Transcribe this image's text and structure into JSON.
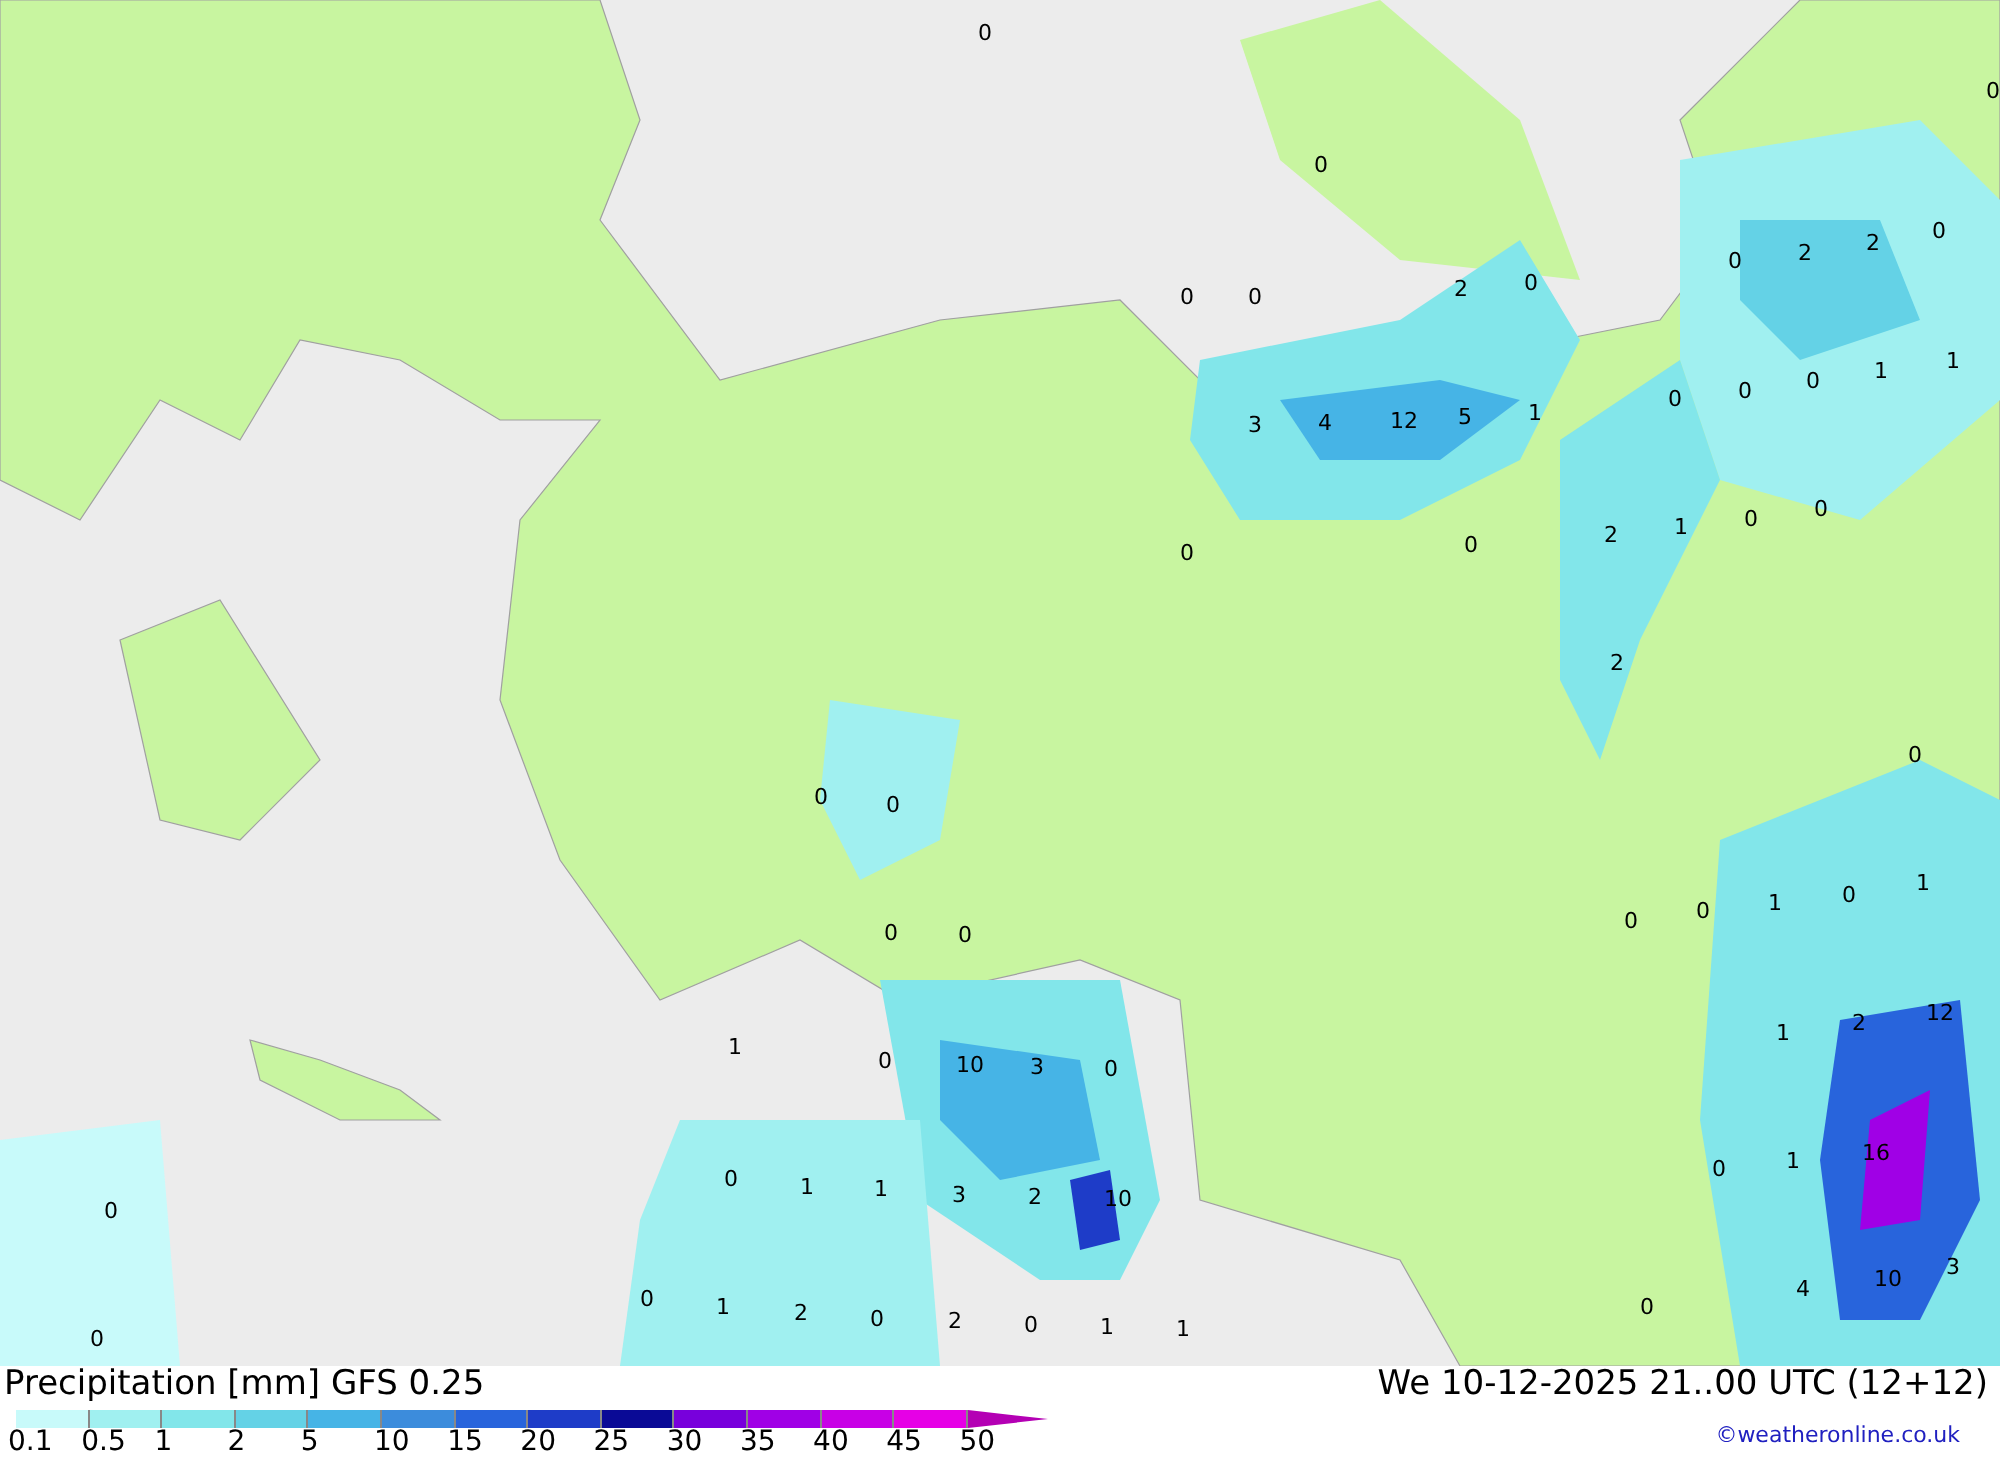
{
  "map_labels": [
    "0",
    "0",
    "0",
    "0",
    "2",
    "0",
    "0",
    "2",
    "2",
    "0",
    "3",
    "4",
    "12",
    "5",
    "1",
    "0",
    "0",
    "0",
    "1",
    "1",
    "0",
    "0",
    "0",
    "2",
    "1",
    "0",
    "0",
    "2",
    "0",
    "0",
    "0",
    "0",
    "0",
    "0",
    "0",
    "1",
    "0",
    "1",
    "1",
    "0",
    "10",
    "3",
    "0",
    "1",
    "2",
    "12",
    "0",
    "1",
    "1",
    "3",
    "2",
    "10",
    "0",
    "0",
    "1",
    "16",
    "3",
    "0",
    "1",
    "2",
    "0",
    "2",
    "0",
    "1",
    "1",
    "0",
    "4",
    "10",
    "0"
  ],
  "title": "Precipitation [mm] GFS 0.25",
  "datetime": "We 10-12-2025 21..00 UTC (12+12)",
  "legend": [
    {
      "label": "0.1",
      "color": "#c8fafa"
    },
    {
      "label": "0.5",
      "color": "#a0f0f0"
    },
    {
      "label": "1",
      "color": "#82e6ea"
    },
    {
      "label": "2",
      "color": "#64d2e6"
    },
    {
      "label": "5",
      "color": "#46b4e6"
    },
    {
      "label": "10",
      "color": "#3c8cdc"
    },
    {
      "label": "15",
      "color": "#2864dc"
    },
    {
      "label": "20",
      "color": "#1e3cc8"
    },
    {
      "label": "25",
      "color": "#0a0a96"
    },
    {
      "label": "30",
      "color": "#7800dc"
    },
    {
      "label": "35",
      "color": "#a000e6"
    },
    {
      "label": "40",
      "color": "#c800e6"
    },
    {
      "label": "45",
      "color": "#e600e6"
    },
    {
      "label": "50",
      "color": "#b400b4"
    }
  ],
  "credit": "©weatheronline.co.uk"
}
